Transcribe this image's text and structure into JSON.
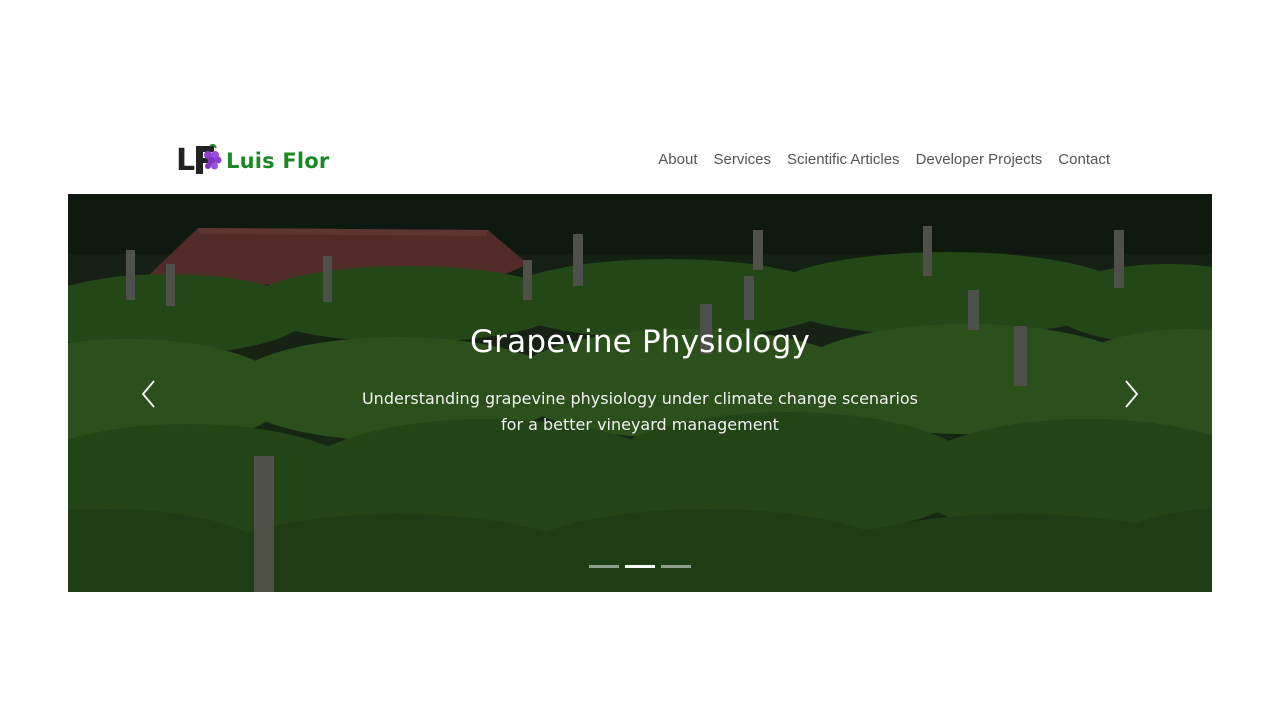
{
  "brand": {
    "logo_letters": "LF",
    "name": "Luis Flor",
    "name_color": "#1b8a24",
    "grape_color": "#8e3fd0"
  },
  "nav": {
    "links": [
      "About",
      "Services",
      "Scientific Articles",
      "Developer Projects",
      "Contact"
    ]
  },
  "carousel": {
    "slide_title": "Grapevine Physiology",
    "slide_text": "Understanding grapevine physiology under climate change scenarios for a better vineyard management",
    "prev_icon": "chevron-left-icon",
    "next_icon": "chevron-right-icon",
    "indicator_count": 3,
    "active_index": 1
  }
}
